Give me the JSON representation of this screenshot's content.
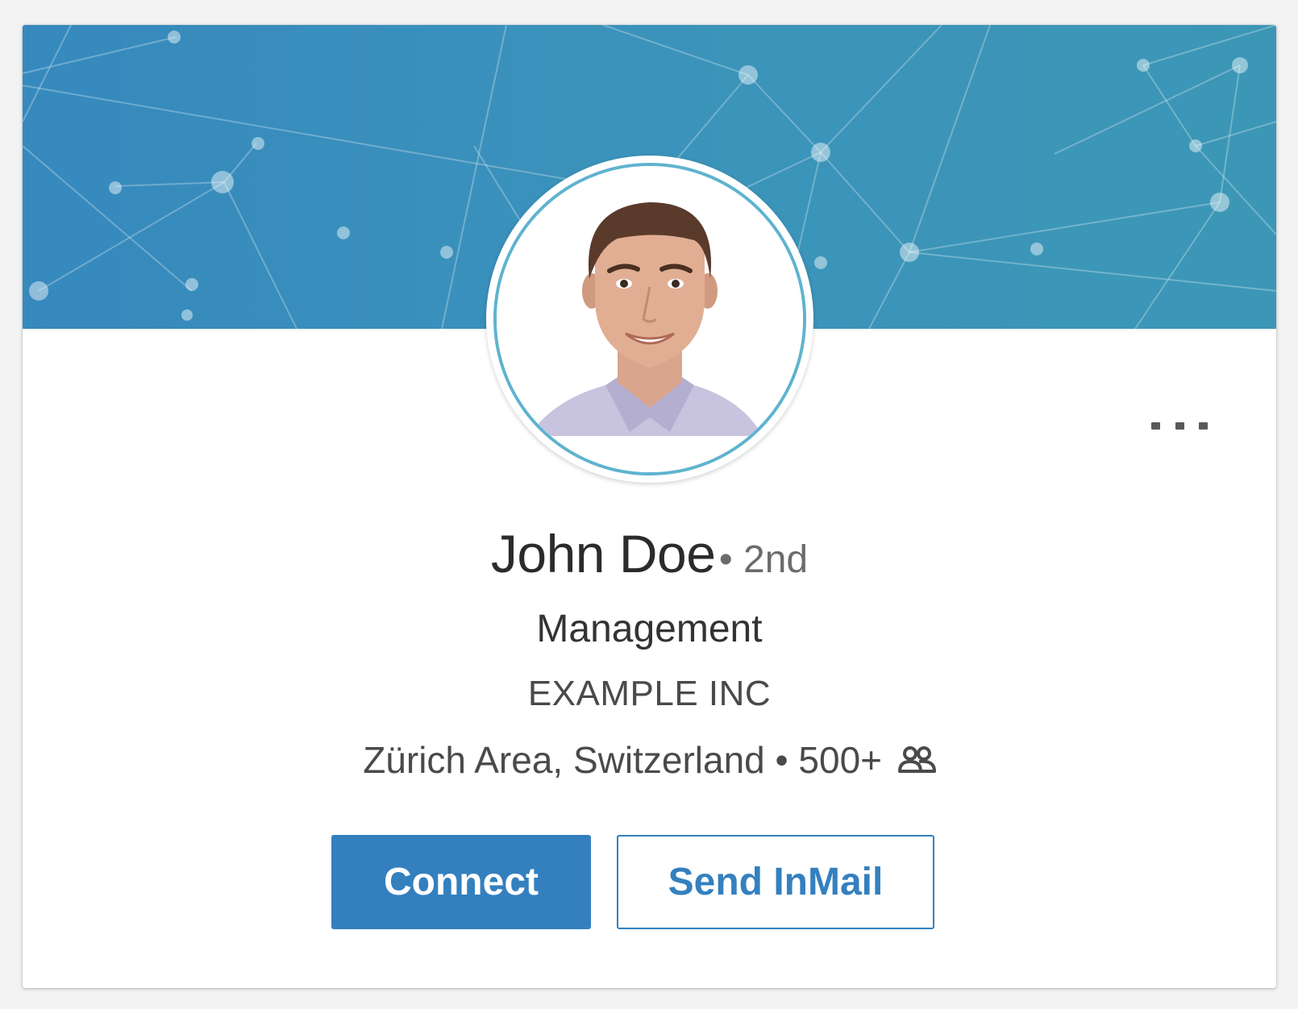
{
  "profile": {
    "name": "John Doe",
    "degree": "• 2nd",
    "headline": "Management",
    "company": "EXAMPLE INC",
    "location": "Zürich Area, Switzerland",
    "separator": "•",
    "connections": "500+",
    "connections_icon": "people-icon"
  },
  "actions": {
    "connect_label": "Connect",
    "inmail_label": "Send InMail",
    "more_icon": "more-options-icon"
  },
  "colors": {
    "banner": "#3b93bb",
    "primary": "#3480bf",
    "avatar_ring": "#5eb3cf"
  }
}
